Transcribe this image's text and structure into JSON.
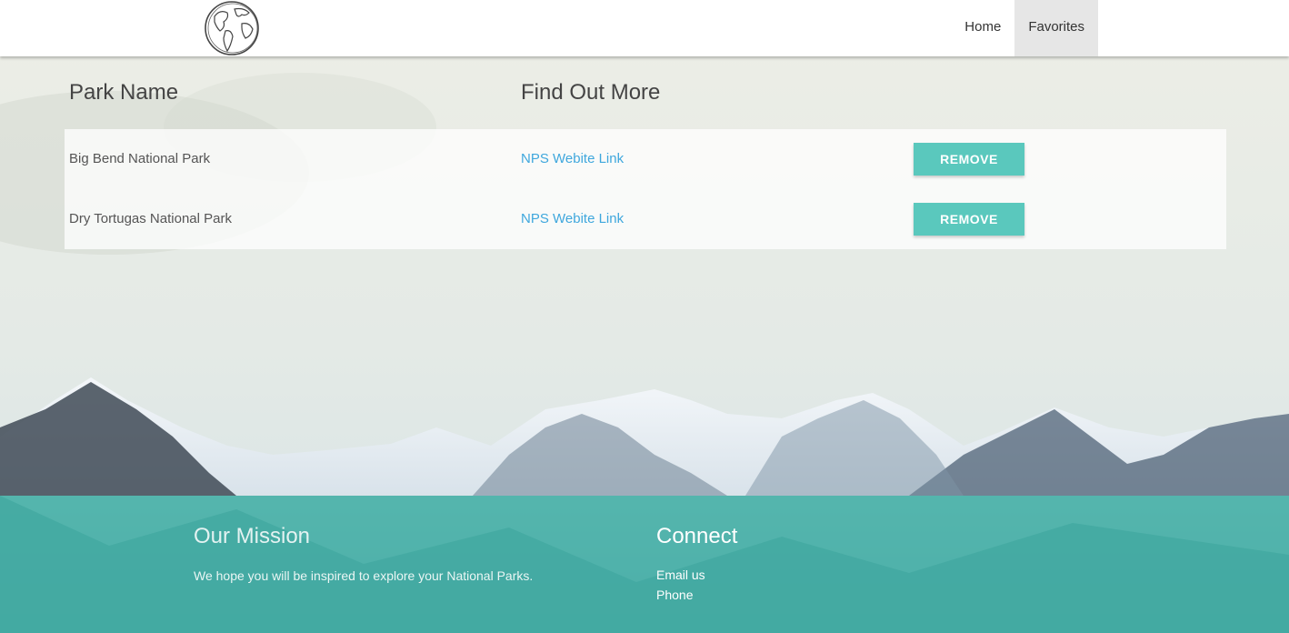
{
  "nav": {
    "logo_icon": "globe-icon",
    "items": [
      {
        "label": "Home",
        "active": false
      },
      {
        "label": "Favorites",
        "active": true
      }
    ]
  },
  "favorites": {
    "headers": {
      "park_name": "Park Name",
      "find_out_more": "Find Out More"
    },
    "rows": [
      {
        "park": "Big Bend National Park",
        "link": "NPS Webite Link",
        "action": "REMOVE"
      },
      {
        "park": "Dry Tortugas National Park",
        "link": "NPS Webite Link",
        "action": "REMOVE"
      }
    ]
  },
  "footer": {
    "mission_title": "Our Mission",
    "mission_text": "We hope you will be inspired to explore your National Parks.",
    "connect_title": "Connect",
    "connect_items": [
      "Email us",
      "Phone"
    ]
  },
  "colors": {
    "accent": "#5ac8bd",
    "link": "#3fa7dd",
    "footer": "#21a396",
    "nav_active": "#e6e6e6"
  }
}
